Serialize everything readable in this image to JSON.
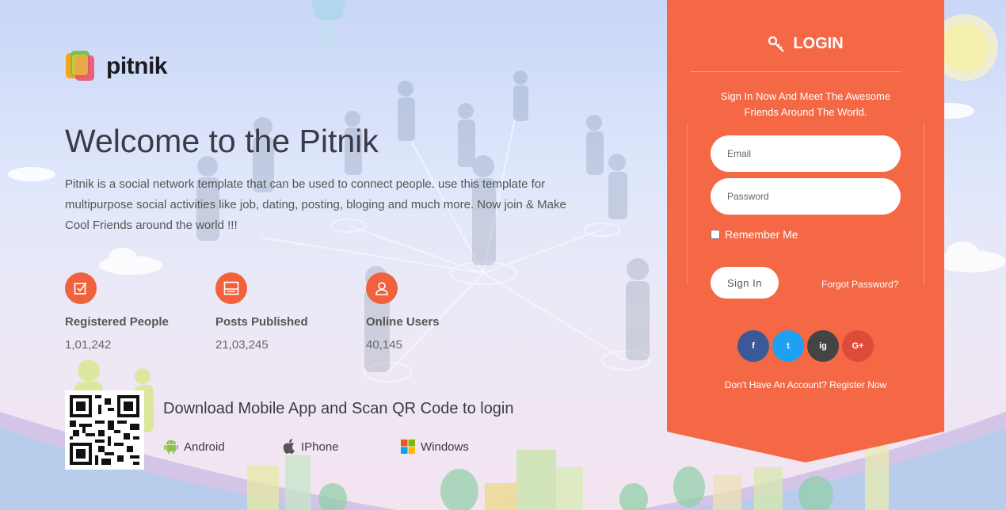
{
  "brand": {
    "name": "pitnik"
  },
  "hero": {
    "title": "Welcome to the Pitnik",
    "description": "Pitnik is a social network template that can be used to connect people. use this template for multipurpose social activities like job, dating, posting, bloging and much more. Now join & Make Cool Friends around the world !!!"
  },
  "stats": [
    {
      "label": "Registered People",
      "value": "1,01,242",
      "icon": "checkbox-icon"
    },
    {
      "label": "Posts Published",
      "value": "21,03,245",
      "icon": "document-icon"
    },
    {
      "label": "Online Users",
      "value": "40,145",
      "icon": "user-icon"
    }
  ],
  "download": {
    "title": "Download Mobile App and Scan QR Code to login",
    "apps": [
      {
        "label": "Android",
        "icon": "android-icon"
      },
      {
        "label": "IPhone",
        "icon": "apple-icon"
      },
      {
        "label": "Windows",
        "icon": "windows-icon"
      }
    ]
  },
  "login": {
    "heading": "LOGIN",
    "tagline": "Sign In Now And Meet The Awesome Friends Around The World.",
    "email_placeholder": "Email",
    "password_placeholder": "Password",
    "remember_label": "Remember Me",
    "signin_label": "Sign In",
    "forgot_label": "Forgot Password?",
    "register_label": "Don't Have An Account? Register Now",
    "social": [
      {
        "label": "f",
        "icon": "facebook-icon",
        "color": "#3b5998"
      },
      {
        "label": "t",
        "icon": "twitter-icon",
        "color": "#1da1f2"
      },
      {
        "label": "ig",
        "icon": "instagram-icon",
        "color": "#444444"
      },
      {
        "label": "G+",
        "icon": "google-plus-icon",
        "color": "#dd4b39"
      }
    ]
  },
  "colors": {
    "accent": "#f46845",
    "stat_icon": "#f0623e"
  }
}
